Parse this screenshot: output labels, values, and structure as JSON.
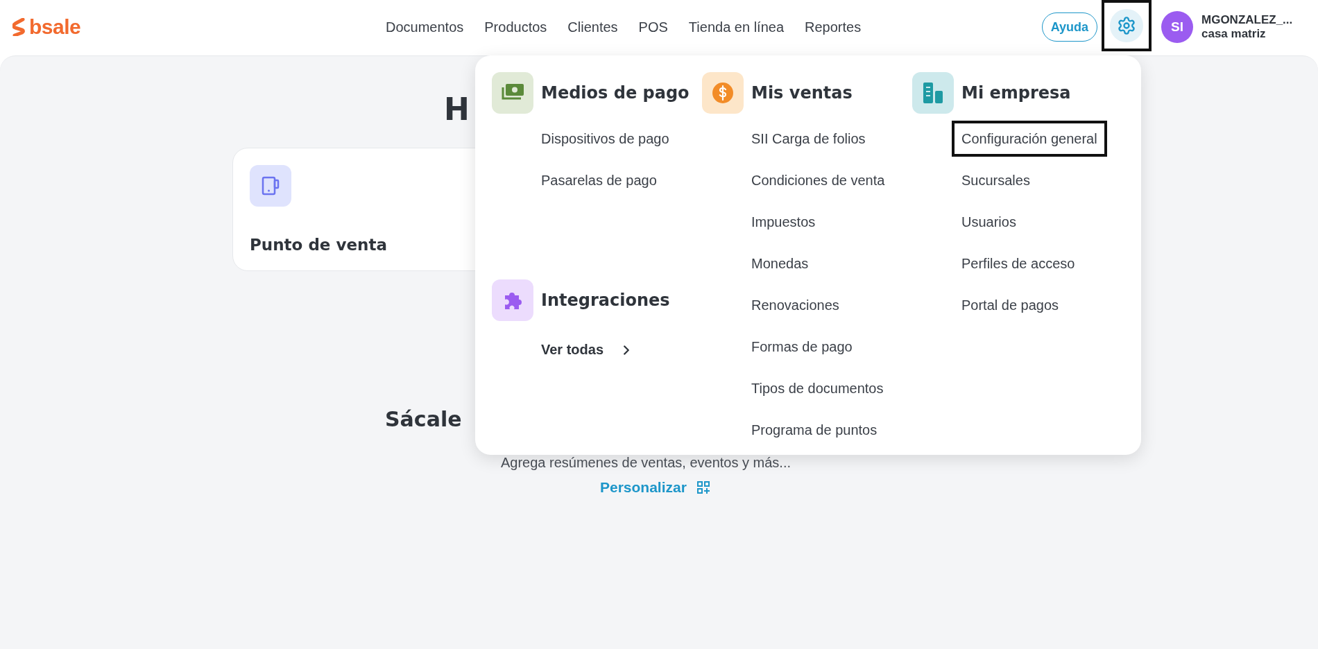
{
  "header": {
    "logo": "bsale",
    "nav": [
      {
        "label": "Documentos"
      },
      {
        "label": "Productos"
      },
      {
        "label": "Clientes"
      },
      {
        "label": "POS"
      },
      {
        "label": "Tienda en línea"
      },
      {
        "label": "Reportes"
      }
    ],
    "help_button": "Ayuda",
    "settings_button": {
      "highlighted": true
    },
    "user": {
      "initials": "SI",
      "name": "MGONZALEZ_...",
      "branch": "casa matriz"
    }
  },
  "page": {
    "title": "H",
    "card": {
      "title": "Punto de venta"
    },
    "section_title": "Sácale",
    "section_text": "Agrega resúmenes de ventas, eventos y más...",
    "customize_link": "Personalizar"
  },
  "menu": {
    "columns": [
      {
        "groups": [
          {
            "kind": "money",
            "title": "Medios de pago",
            "items": [
              {
                "label": "Dispositivos de pago",
                "highlighted": false
              },
              {
                "label": "Pasarelas de pago",
                "highlighted": false
              }
            ]
          },
          {
            "kind": "puzzle",
            "title": "Integraciones",
            "link": "Ver todas"
          }
        ]
      },
      {
        "groups": [
          {
            "kind": "dollar",
            "title": "Mis ventas",
            "items": [
              {
                "label": "SII Carga de folios",
                "highlighted": false
              },
              {
                "label": "Condiciones de venta",
                "highlighted": false
              },
              {
                "label": "Impuestos",
                "highlighted": false
              },
              {
                "label": "Monedas",
                "highlighted": false
              },
              {
                "label": "Renovaciones",
                "highlighted": false
              },
              {
                "label": "Formas de pago",
                "highlighted": false
              },
              {
                "label": "Tipos de documentos",
                "highlighted": false
              },
              {
                "label": "Programa de puntos",
                "highlighted": false
              }
            ]
          }
        ]
      },
      {
        "groups": [
          {
            "kind": "building",
            "title": "Mi empresa",
            "items": [
              {
                "label": "Configuración general",
                "highlighted": true
              },
              {
                "label": "Sucursales",
                "highlighted": false
              },
              {
                "label": "Usuarios",
                "highlighted": false
              },
              {
                "label": "Perfiles de acceso",
                "highlighted": false
              },
              {
                "label": "Portal de pagos",
                "highlighted": false
              }
            ]
          }
        ]
      }
    ]
  }
}
